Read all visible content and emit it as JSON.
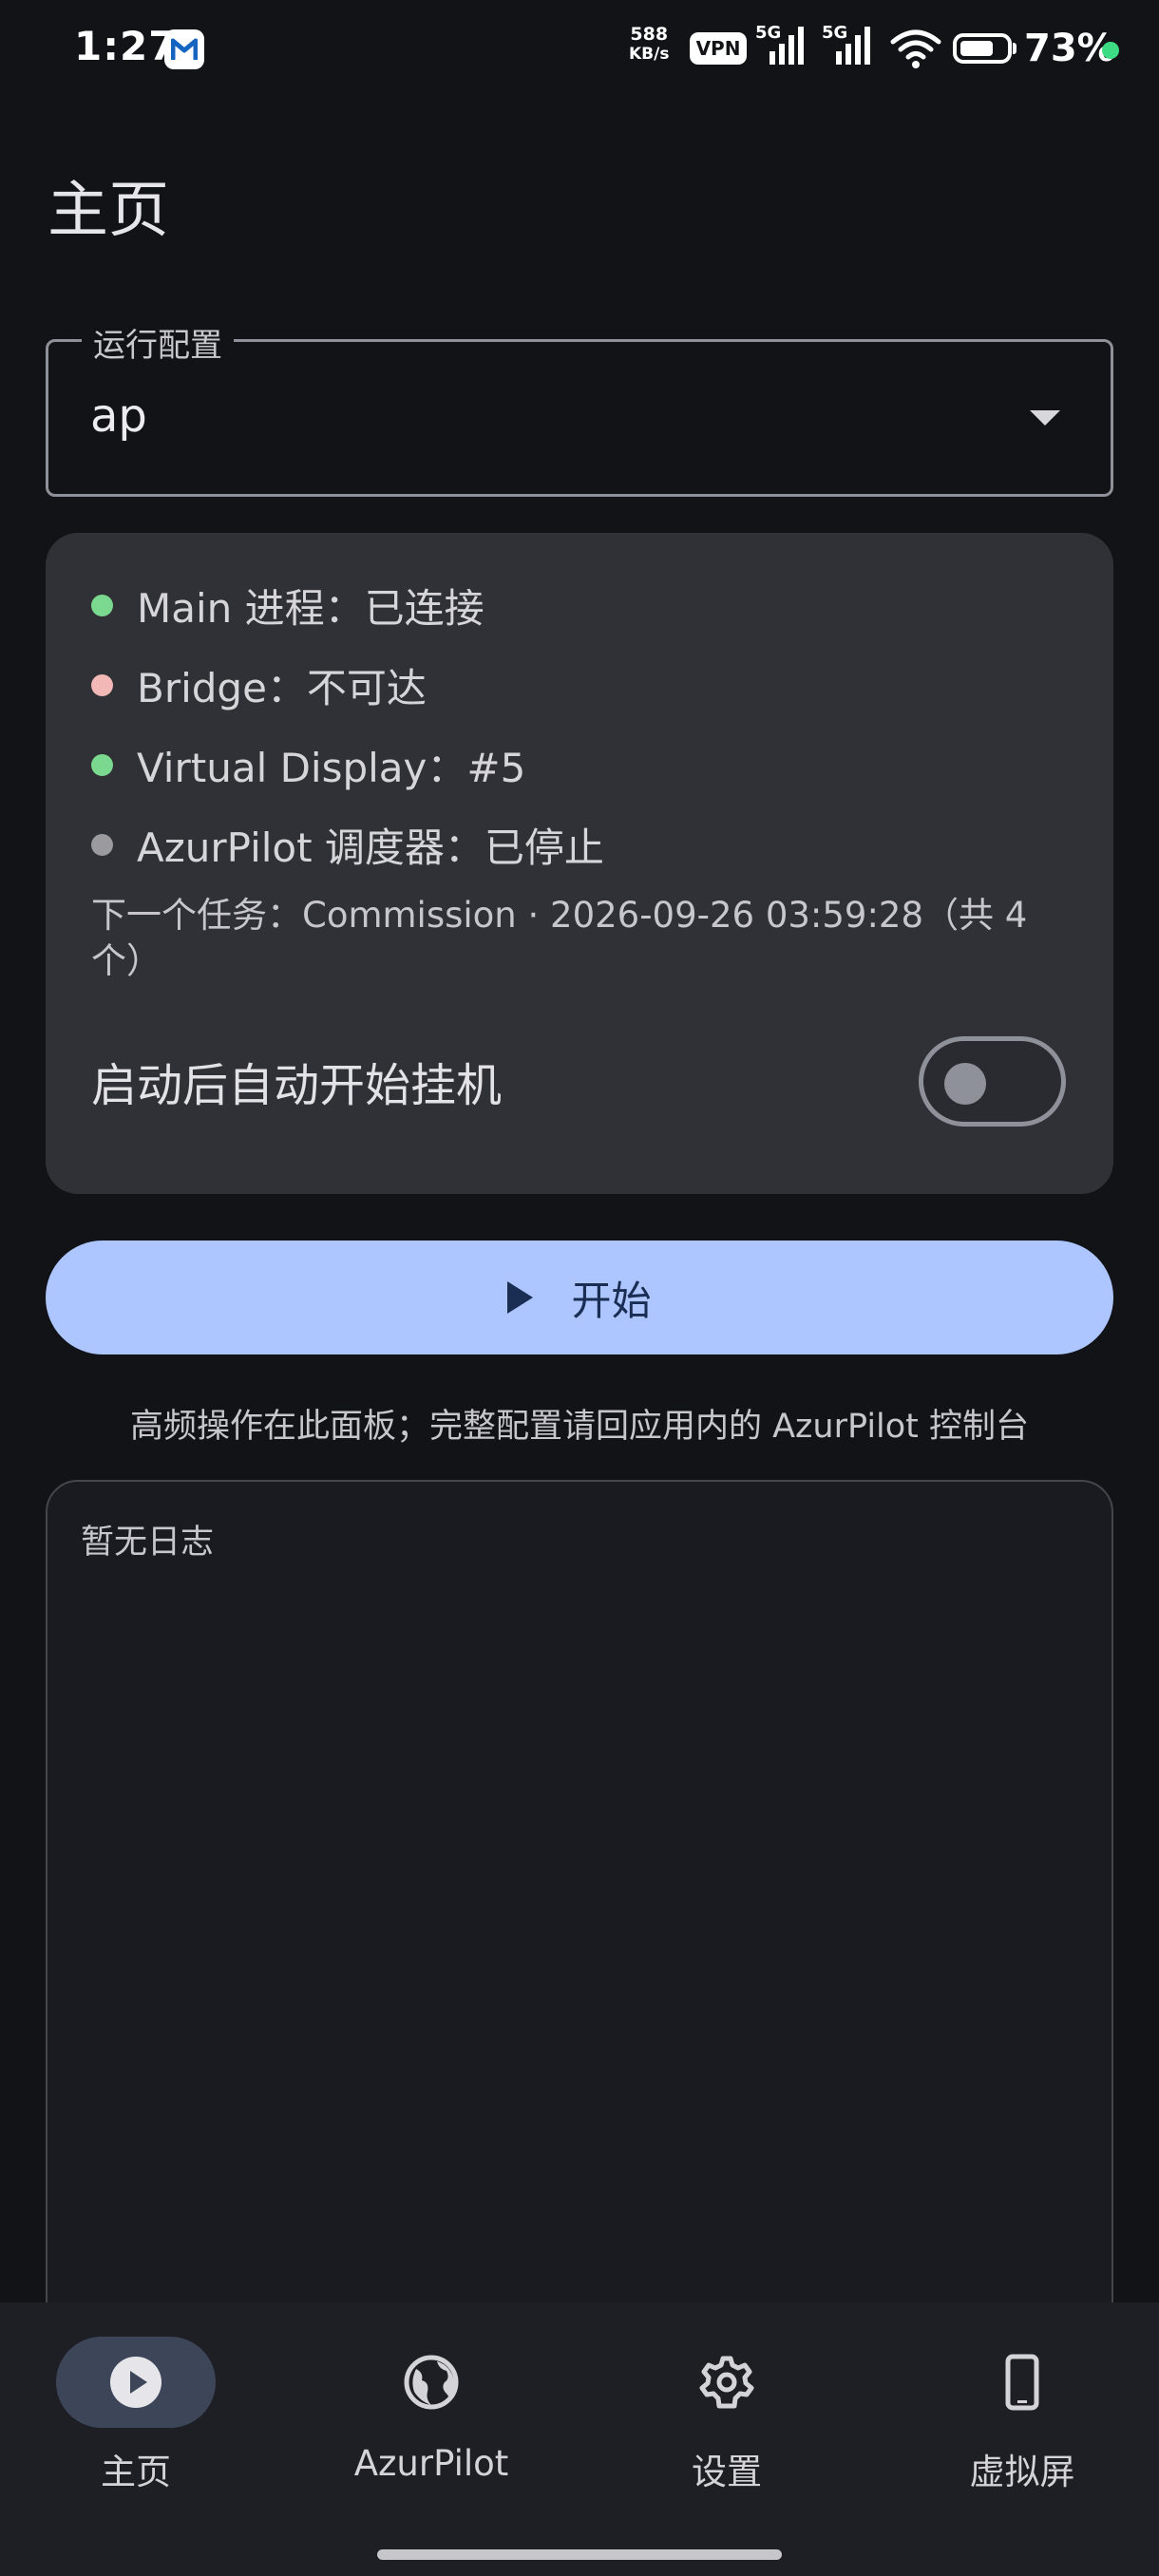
{
  "status_bar": {
    "time": "1:27",
    "net_speed_value": "588",
    "net_speed_unit": "KB/s",
    "vpn": "VPN",
    "sim1": "5G",
    "sim2": "5G",
    "battery_percent": "73%",
    "battery_level": 0.73
  },
  "page": {
    "title": "主页"
  },
  "config": {
    "legend": "运行配置",
    "value": "ap"
  },
  "status_card": {
    "rows": [
      {
        "label": "Main 进程：已连接",
        "color": "#7bd88f"
      },
      {
        "label": "Bridge：不可达",
        "color": "#f2b8b5"
      },
      {
        "label": "Virtual Display：#5",
        "color": "#7bd88f"
      },
      {
        "label": "AzurPilot 调度器：已停止",
        "color": "#9a9a9f"
      }
    ],
    "next_task": "下一个任务：Commission · 2026-09-26 03:59:28（共 4 个）",
    "auto_start_label": "启动后自动开始挂机",
    "auto_start_on": false
  },
  "actions": {
    "start_label": "开始"
  },
  "hint": "高频操作在此面板；完整配置请回应用内的 AzurPilot 控制台",
  "log": {
    "empty_text": "暂无日志"
  },
  "nav": {
    "items": [
      {
        "label": "主页",
        "icon": "play-circle-icon",
        "active": true
      },
      {
        "label": "AzurPilot",
        "icon": "globe-icon",
        "active": false
      },
      {
        "label": "设置",
        "icon": "gear-icon",
        "active": false
      },
      {
        "label": "虚拟屏",
        "icon": "phone-icon",
        "active": false
      }
    ]
  },
  "colors": {
    "background": "#121317",
    "card": "#303136",
    "primary_button": "#aec6ff",
    "nav_active_pill": "#3d4659"
  }
}
